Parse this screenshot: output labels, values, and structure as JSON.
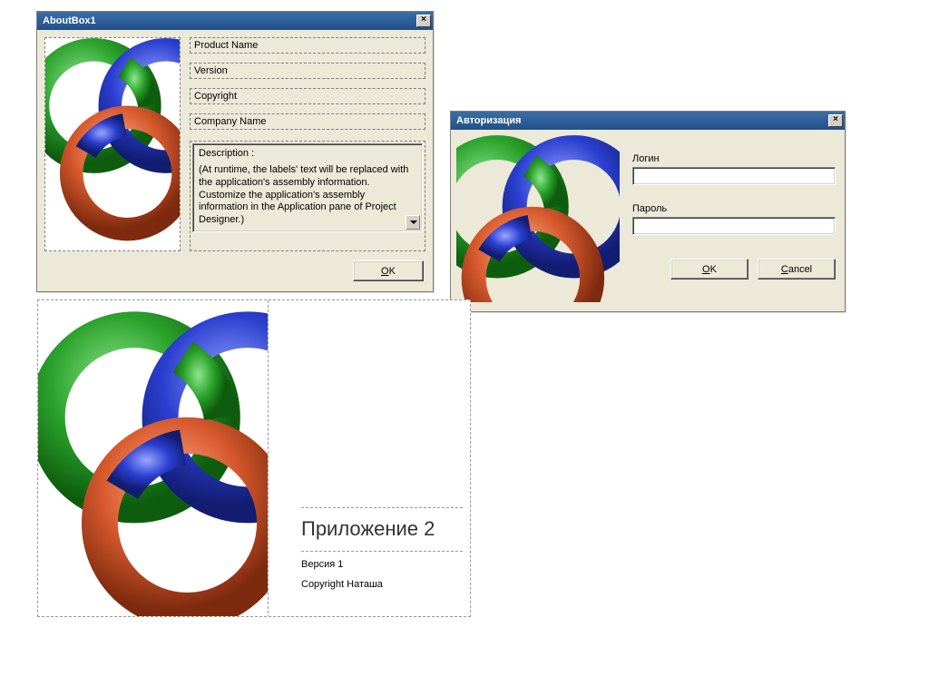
{
  "about": {
    "title": "AboutBox1",
    "product_name": "Product Name",
    "version": "Version",
    "copyright": "Copyright",
    "company": "Company Name",
    "description_label": "Description :",
    "description_text": "(At runtime, the labels' text will be replaced with the application's assembly information. Customize the application's assembly information in the Application pane of Project Designer.)",
    "ok_label": "OK"
  },
  "auth": {
    "title": "Авторизация",
    "login_label": "Логин",
    "password_label": "Пароль",
    "ok_label": "OK",
    "cancel_label": "Cancel"
  },
  "splash": {
    "app_title": "Приложение 2",
    "version": "Версия 1",
    "copyright": "Copyright Наташа"
  },
  "icons": {
    "close": "×"
  },
  "colors": {
    "ring_green": "#2aa12a",
    "ring_blue": "#2a3fd0",
    "ring_red": "#d85a2e"
  }
}
